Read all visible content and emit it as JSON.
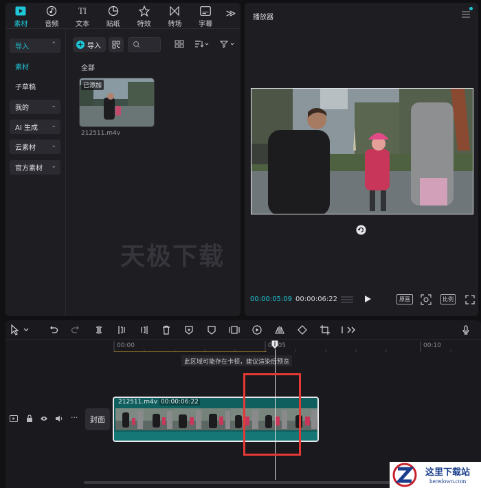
{
  "tabs": [
    {
      "label": "素材",
      "icon": "media-icon",
      "active": true
    },
    {
      "label": "音频",
      "icon": "audio-icon"
    },
    {
      "label": "文本",
      "icon": "text-icon"
    },
    {
      "label": "贴纸",
      "icon": "sticker-icon"
    },
    {
      "label": "特效",
      "icon": "effects-icon"
    },
    {
      "label": "转场",
      "icon": "transition-icon"
    },
    {
      "label": "字幕",
      "icon": "subtitle-icon"
    }
  ],
  "sidebar": {
    "import": "导入",
    "items": [
      {
        "label": "素材",
        "active": true
      },
      {
        "label": "子草稿"
      }
    ],
    "groups": [
      "我的",
      "AI 生成",
      "云素材",
      "官方素材"
    ]
  },
  "media": {
    "import_button": "导入",
    "section_label": "全部",
    "items": [
      {
        "name": "212511.m4v",
        "badge": "已添加"
      }
    ],
    "watermark": "天极下载"
  },
  "player": {
    "title": "播放器",
    "current_time": "00:00:05:09",
    "total_time": "00:00:06:22",
    "btn_original": "原画",
    "btn_ratio": "比例"
  },
  "timeline": {
    "ruler_labels": [
      "00:00",
      "00:05",
      "00:10"
    ],
    "notice": "此区域可能存在卡顿，建议渲染后预览",
    "cover_label": "封面",
    "clip": {
      "name": "212511.m4v",
      "duration": "00:00:06:22"
    }
  },
  "footer_watermark": {
    "title": "这里下载站",
    "url": "heredown.com"
  },
  "colors": {
    "accent": "#1fc6d8",
    "highlight": "#e53935",
    "clip": "#0f5f5e"
  }
}
